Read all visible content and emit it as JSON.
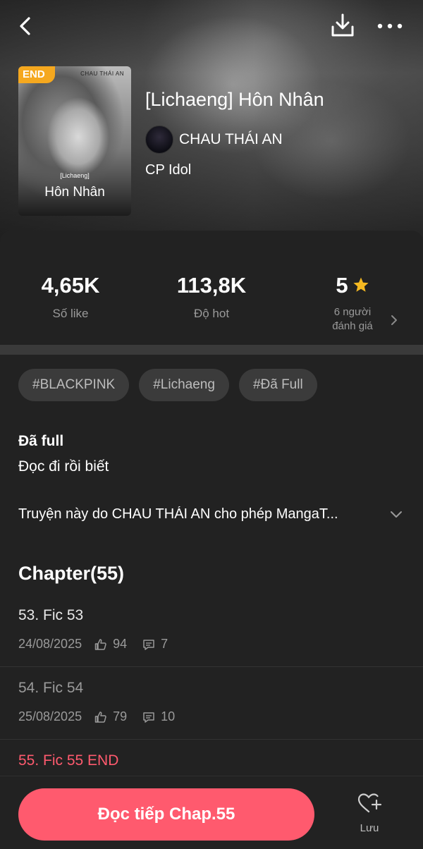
{
  "header": {
    "title": "[Lichaeng] Hôn Nhân",
    "author": "CHAU THÁI AN",
    "genre": "CP Idol"
  },
  "cover": {
    "badge": "END",
    "author_text": "CHAU THÁI AN",
    "tag_text": "[Lichaeng]",
    "title_text": "Hôn Nhân"
  },
  "stats": {
    "likes_value": "4,65K",
    "likes_label": "Số like",
    "hot_value": "113,8K",
    "hot_label": "Độ hot",
    "rating_value": "5",
    "rating_label_line1": "6 người",
    "rating_label_line2": "đánh giá"
  },
  "tags": [
    "#BLACKPINK",
    "#Lichaeng",
    "#Đã Full"
  ],
  "description": {
    "status_heading": "Đã full",
    "status_text": "Đọc đi rồi biết",
    "license_text": "Truyện này do CHAU THÁI AN cho phép MangaT..."
  },
  "chapters": {
    "heading": "Chapter(55)",
    "items": [
      {
        "title": "53. Fic 53",
        "date": "24/08/2025",
        "likes": "94",
        "comments": "7"
      },
      {
        "title": "54. Fic 54",
        "date": "25/08/2025",
        "likes": "79",
        "comments": "10"
      },
      {
        "title": "55. Fic 55 END"
      }
    ]
  },
  "bottom": {
    "read_label": "Đọc tiếp Chap.55",
    "save_label": "Lưu"
  },
  "colors": {
    "accent": "#ff5a6e",
    "badge": "#f5a81f",
    "star": "#f5b921",
    "read_chapter_title": "#9a9a9a",
    "current_chapter_title": "#ff5a6e"
  },
  "icons": [
    "back-arrow-icon",
    "download-icon",
    "more-dots-icon",
    "star-icon",
    "chevron-right-icon",
    "chevron-down-icon",
    "thumb-up-icon",
    "comment-icon",
    "heart-plus-icon"
  ]
}
